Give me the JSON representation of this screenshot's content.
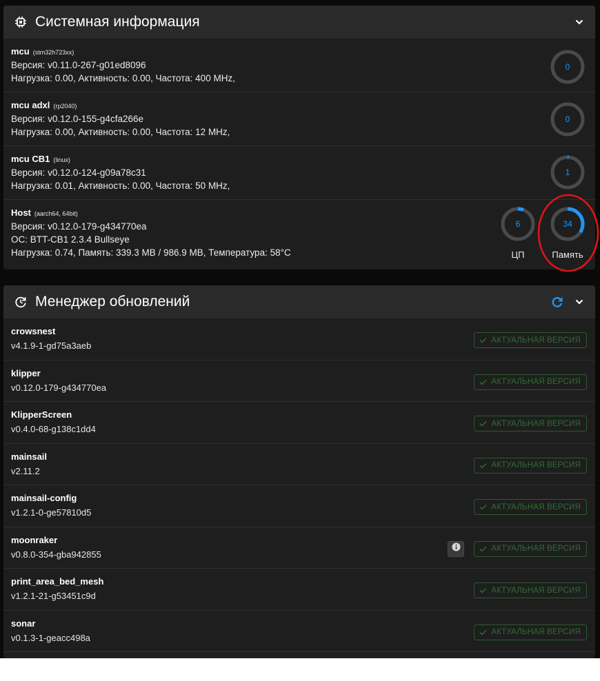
{
  "system": {
    "title": "Системная информация",
    "mcus": [
      {
        "name": "mcu",
        "chip": "(stm32h723xx)",
        "version": "Версия: v0.11.0-267-g01ed8096",
        "load": "Нагрузка: 0.00, Активность: 0.00, Частота: 400 MHz,",
        "gauge": "0",
        "gauge_pct": 0
      },
      {
        "name": "mcu adxl",
        "chip": "(rp2040)",
        "version": "Версия: v0.12.0-155-g4cfa266e",
        "load": "Нагрузка: 0.00, Активность: 0.00, Частота: 12 MHz,",
        "gauge": "0",
        "gauge_pct": 0
      },
      {
        "name": "mcu CB1",
        "chip": "(linux)",
        "version": "Версия: v0.12.0-124-g09a78c31",
        "load": "Нагрузка: 0.01, Активность: 0.00, Частота: 50 MHz,",
        "gauge": "1",
        "gauge_pct": 1
      }
    ],
    "host": {
      "name": "Host",
      "chip": "(aarch64, 64bit)",
      "version": "Версия: v0.12.0-179-g434770ea",
      "os": "ОС: BTT-CB1 2.3.4 Bullseye",
      "load": "Нагрузка: 0.74, Память: 339.3 MB / 986.9 MB, Температура: 58°C",
      "cpu_value": "6",
      "cpu_pct": 6,
      "cpu_label": "ЦП",
      "mem_value": "34",
      "mem_pct": 34,
      "mem_label": "Память"
    }
  },
  "updates": {
    "title": "Менеджер обновлений",
    "status_label": "АКТУАЛЬНАЯ ВЕРСИЯ",
    "items": [
      {
        "name": "crowsnest",
        "version": "v4.1.9-1-gd75a3aeb"
      },
      {
        "name": "klipper",
        "version": "v0.12.0-179-g434770ea"
      },
      {
        "name": "KlipperScreen",
        "version": "v0.4.0-68-g138c1dd4"
      },
      {
        "name": "mainsail",
        "version": "v2.11.2"
      },
      {
        "name": "mainsail-config",
        "version": "v1.2.1-0-ge57810d5"
      },
      {
        "name": "moonraker",
        "version": "v0.8.0-354-gba942855"
      },
      {
        "name": "print_area_bed_mesh",
        "version": "v1.2.1-21-g53451c9d"
      },
      {
        "name": "sonar",
        "version": "v0.1.3-1-geacc498a"
      }
    ]
  },
  "colors": {
    "accent": "#2196f3",
    "ok_green": "#2d6f31",
    "annotation_red": "#e0141b"
  },
  "icons": {
    "system_header": "chip-icon",
    "update_header": "update-icon",
    "refresh": "refresh-icon",
    "collapse": "chevron-down-icon",
    "info": "info-icon",
    "status": "check-icon"
  }
}
